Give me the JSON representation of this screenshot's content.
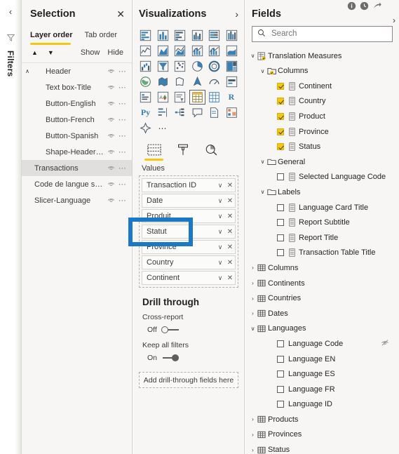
{
  "filters_rail": {
    "label": "Filters",
    "collapse_icon": "chevron-left-icon",
    "funnel_icon": "filter-funnel-icon"
  },
  "selection": {
    "title": "Selection",
    "close_label": "✕",
    "tabs": [
      {
        "label": "Layer order",
        "active": true
      },
      {
        "label": "Tab order",
        "active": false
      }
    ],
    "move_up_label": "▲",
    "move_down_label": "▼",
    "show_label": "Show",
    "hide_label": "Hide",
    "items": [
      {
        "label": "Header",
        "indent": "root",
        "caret": "∧",
        "selected": false
      },
      {
        "label": "Text box-Title",
        "indent": "1",
        "caret": "",
        "selected": false
      },
      {
        "label": "Button-English",
        "indent": "1",
        "caret": "",
        "selected": false
      },
      {
        "label": "Button-French",
        "indent": "1",
        "caret": "",
        "selected": false
      },
      {
        "label": "Button-Spanish",
        "indent": "1",
        "caret": "",
        "selected": false
      },
      {
        "label": "Shape-Header Ba...",
        "indent": "1",
        "caret": "",
        "selected": false
      },
      {
        "label": "Transactions",
        "indent": "0",
        "caret": "",
        "selected": true
      },
      {
        "label": "Code de langue sélec...",
        "indent": "0",
        "caret": "",
        "selected": false
      },
      {
        "label": "Slicer-Language",
        "indent": "0",
        "caret": "",
        "selected": false
      }
    ]
  },
  "visualizations": {
    "title": "Visualizations",
    "expand_icon": "chevron-right-icon",
    "gallery": [
      "stacked-bar-chart-icon",
      "stacked-column-chart-icon",
      "clustered-bar-chart-icon",
      "clustered-column-chart-icon",
      "100-stacked-bar-chart-icon",
      "100-stacked-column-chart-icon",
      "line-chart-icon",
      "area-chart-icon",
      "stacked-area-chart-icon",
      "line-stacked-column-chart-icon",
      "line-clustered-column-chart-icon",
      "ribbon-chart-icon",
      "waterfall-chart-icon",
      "funnel-chart-icon",
      "scatter-chart-icon",
      "pie-chart-icon",
      "donut-chart-icon",
      "treemap-icon",
      "map-icon",
      "filled-map-icon",
      "shape-map-icon",
      "azure-map-icon",
      "gauge-icon",
      "card-icon",
      "multi-row-card-icon",
      "kpi-icon",
      "slicer-icon",
      "table-icon",
      "matrix-icon",
      "r-script-visual-icon",
      "python-visual-icon",
      "key-influencers-icon",
      "decomposition-tree-icon",
      "qa-visual-icon",
      "paginated-report-icon",
      "power-apps-icon",
      "smart-narrative-icon",
      "more-options-icon"
    ],
    "gallery_text": {
      "r": "R",
      "py": "Py",
      "dots": "⋯"
    },
    "selected_visual": "table-icon",
    "panel_tabs": [
      {
        "name": "fields-tab",
        "icon": "fields-table-icon",
        "active": true
      },
      {
        "name": "format-tab",
        "icon": "paint-roller-icon",
        "active": false
      },
      {
        "name": "analytics-tab",
        "icon": "analytics-magnifier-icon",
        "active": false
      }
    ],
    "values_label": "Values",
    "values": [
      {
        "label": "Transaction ID"
      },
      {
        "label": "Date"
      },
      {
        "label": "Produit"
      },
      {
        "label": "Statut"
      },
      {
        "label": "Province"
      },
      {
        "label": "Country"
      },
      {
        "label": "Continent"
      }
    ],
    "well_caret": "∨",
    "well_remove": "✕",
    "drill_through": {
      "title": "Drill through",
      "cross_report_label": "Cross-report",
      "cross_report_state": "Off",
      "keep_filters_label": "Keep all filters",
      "keep_filters_state": "On",
      "drop_zone_label": "Add drill-through fields here"
    }
  },
  "fields": {
    "title": "Fields",
    "expand_icon": "chevron-right-icon",
    "search_placeholder": "Search",
    "search_value": "",
    "search_icon": "search-icon",
    "tree": [
      {
        "label": "Translation Measures",
        "level": 0,
        "caret": "∨",
        "icon": "measure-table-icon",
        "checkbox": "none"
      },
      {
        "label": "Columns",
        "level": 1,
        "caret": "∨",
        "icon": "folder-icon",
        "checkbox": "none"
      },
      {
        "label": "Continent",
        "level": 2,
        "caret": "",
        "icon": "measure-icon",
        "checkbox": "checked"
      },
      {
        "label": "Country",
        "level": 2,
        "caret": "",
        "icon": "measure-icon",
        "checkbox": "checked"
      },
      {
        "label": "Product",
        "level": 2,
        "caret": "",
        "icon": "measure-icon",
        "checkbox": "checked"
      },
      {
        "label": "Province",
        "level": 2,
        "caret": "",
        "icon": "measure-icon",
        "checkbox": "checked"
      },
      {
        "label": "Status",
        "level": 2,
        "caret": "",
        "icon": "measure-icon",
        "checkbox": "checked"
      },
      {
        "label": "General",
        "level": 1,
        "caret": "∨",
        "icon": "folder-icon",
        "checkbox": "none"
      },
      {
        "label": "Selected Language Code",
        "level": 2,
        "caret": "",
        "icon": "measure-icon",
        "checkbox": "unchecked"
      },
      {
        "label": "Labels",
        "level": 1,
        "caret": "∨",
        "icon": "folder-icon",
        "checkbox": "none"
      },
      {
        "label": "Language Card Title",
        "level": 2,
        "caret": "",
        "icon": "measure-icon",
        "checkbox": "unchecked"
      },
      {
        "label": "Report Subtitle",
        "level": 2,
        "caret": "",
        "icon": "measure-icon",
        "checkbox": "unchecked"
      },
      {
        "label": "Report Title",
        "level": 2,
        "caret": "",
        "icon": "measure-icon",
        "checkbox": "unchecked"
      },
      {
        "label": "Transaction Table Title",
        "level": 2,
        "caret": "",
        "icon": "measure-icon",
        "checkbox": "unchecked"
      },
      {
        "label": "Columns",
        "level": 0,
        "caret": "›",
        "icon": "table-icon",
        "checkbox": "none"
      },
      {
        "label": "Continents",
        "level": 0,
        "caret": "›",
        "icon": "table-icon",
        "checkbox": "none"
      },
      {
        "label": "Countries",
        "level": 0,
        "caret": "›",
        "icon": "table-icon",
        "checkbox": "none"
      },
      {
        "label": "Dates",
        "level": 0,
        "caret": "›",
        "icon": "table-icon",
        "checkbox": "none"
      },
      {
        "label": "Languages",
        "level": 0,
        "caret": "∨",
        "icon": "table-icon",
        "checkbox": "none"
      },
      {
        "label": "Language Code",
        "level": 2,
        "caret": "",
        "icon": "",
        "checkbox": "unchecked",
        "hidden_icon": "hidden-eye-icon"
      },
      {
        "label": "Language EN",
        "level": 2,
        "caret": "",
        "icon": "",
        "checkbox": "unchecked"
      },
      {
        "label": "Language ES",
        "level": 2,
        "caret": "",
        "icon": "",
        "checkbox": "unchecked"
      },
      {
        "label": "Language FR",
        "level": 2,
        "caret": "",
        "icon": "",
        "checkbox": "unchecked"
      },
      {
        "label": "Language ID",
        "level": 2,
        "caret": "",
        "icon": "",
        "checkbox": "unchecked"
      },
      {
        "label": "Products",
        "level": 0,
        "caret": "›",
        "icon": "table-icon",
        "checkbox": "none"
      },
      {
        "label": "Provinces",
        "level": 0,
        "caret": "›",
        "icon": "table-icon",
        "checkbox": "none"
      },
      {
        "label": "Status",
        "level": 0,
        "caret": "›",
        "icon": "table-icon",
        "checkbox": "none"
      }
    ]
  },
  "top_icons": [
    {
      "name": "info-icon"
    },
    {
      "name": "clock-history-icon"
    },
    {
      "name": "share-arrow-icon"
    }
  ],
  "highlight": {
    "name": "annotation-rectangle",
    "color": "#1b77c8",
    "target": "Statut"
  },
  "colors": {
    "accent_yellow": "#f2c811",
    "highlight_blue": "#1b77c8",
    "pane_bg": "#f7f6f5",
    "selected_row": "#e1dfdd",
    "viz_icon_blue": "#3c7fb1"
  }
}
